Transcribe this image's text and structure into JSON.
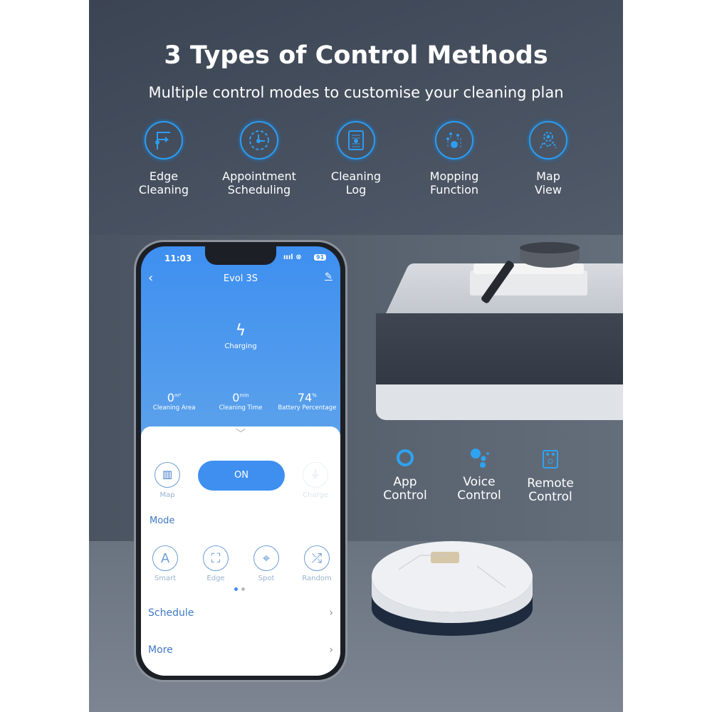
{
  "heading": {
    "title": "3 Types of Control Methods",
    "subtitle": "Multiple control modes to customise your cleaning plan"
  },
  "features": [
    {
      "line1": "Edge",
      "line2": "Cleaning",
      "icon": "edge-cleaning-icon"
    },
    {
      "line1": "Appointment",
      "line2": "Scheduling",
      "icon": "clock-icon"
    },
    {
      "line1": "Cleaning",
      "line2": "Log",
      "icon": "log-icon"
    },
    {
      "line1": "Mopping",
      "line2": "Function",
      "icon": "mopping-icon"
    },
    {
      "line1": "Map",
      "line2": "View",
      "icon": "map-pin-icon"
    }
  ],
  "controls": [
    {
      "line1": "App",
      "line2": "Control",
      "icon": "alexa-ring-icon"
    },
    {
      "line1": "Voice",
      "line2": "Control",
      "icon": "google-assistant-icon"
    },
    {
      "line1": "Remote",
      "line2": "Control",
      "icon": "remote-icon"
    }
  ],
  "app": {
    "status_bar": {
      "time": "11:03",
      "battery": "91"
    },
    "header": {
      "title": "Evol 3S"
    },
    "status": "Charging",
    "stats": [
      {
        "value": "0",
        "unit": "m²",
        "label": "Cleaning Area"
      },
      {
        "value": "0",
        "unit": "min",
        "label": "Cleaning Time"
      },
      {
        "value": "74",
        "unit": "%",
        "label": "Battery Percentage"
      }
    ],
    "controls": {
      "map": "Map",
      "on": "ON",
      "charge": "Charge"
    },
    "mode_title": "Mode",
    "modes": [
      {
        "label": "Smart",
        "glyph": "A"
      },
      {
        "label": "Edge",
        "glyph": "⛶"
      },
      {
        "label": "Spot",
        "glyph": "⌖"
      },
      {
        "label": "Random",
        "glyph": "⤮"
      }
    ],
    "rows": [
      {
        "label": "Schedule",
        "chev": "›"
      },
      {
        "label": "More",
        "chev": "›"
      }
    ]
  },
  "colors": {
    "accent": "#3e8ff0",
    "icon_blue": "#2e9cf0"
  }
}
